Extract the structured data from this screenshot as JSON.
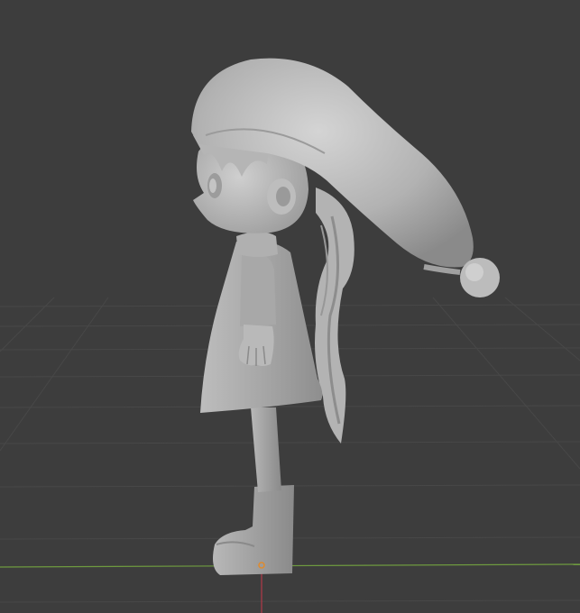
{
  "viewport": {
    "background": "#3d3d3d",
    "grid_color": "#4a4a4a",
    "x_axis_color": "#6e9a3f",
    "z_axis_color": "#b23a48",
    "origin_color": "#e08a2c"
  },
  "model": {
    "shade_light": "#c8c8c8",
    "shade_mid": "#a9a9a9",
    "shade_dark": "#7a7a7a"
  }
}
